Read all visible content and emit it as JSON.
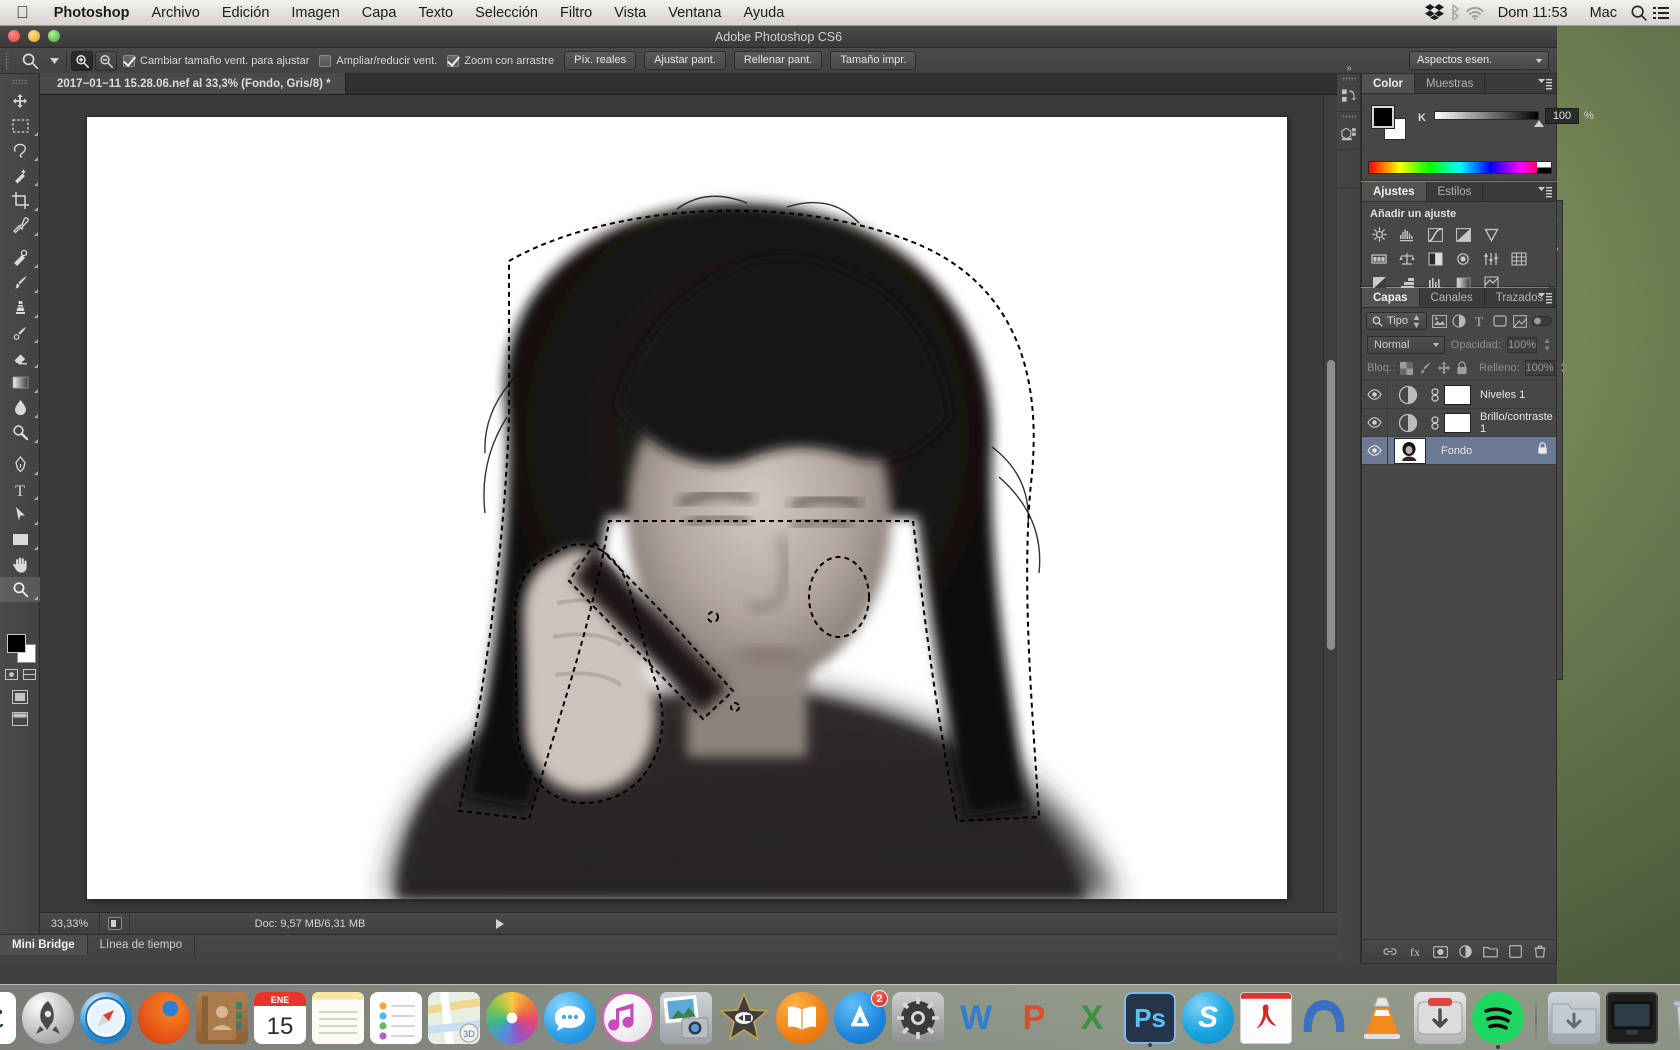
{
  "menubar": {
    "apple_icon": "apple-logo",
    "items": [
      {
        "label": "Photoshop",
        "bold": true
      },
      {
        "label": "Archivo",
        "bold": false
      },
      {
        "label": "Edición",
        "bold": false
      },
      {
        "label": "Imagen",
        "bold": false
      },
      {
        "label": "Capa",
        "bold": false
      },
      {
        "label": "Texto",
        "bold": false
      },
      {
        "label": "Selección",
        "bold": false
      },
      {
        "label": "Filtro",
        "bold": false
      },
      {
        "label": "Vista",
        "bold": false
      },
      {
        "label": "Ventana",
        "bold": false
      },
      {
        "label": "Ayuda",
        "bold": false
      }
    ],
    "status": {
      "dropbox_icon": "dropbox-icon",
      "bluetooth_icon": "bluetooth-icon",
      "wifi_icon": "wifi-icon",
      "clock": "Dom 11:53",
      "user": "Mac",
      "search_icon": "spotlight-search-icon",
      "notifications_icon": "notification-center-icon"
    }
  },
  "window": {
    "title": "Adobe Photoshop CS6"
  },
  "options_bar": {
    "tool_icon": "zoom-tool-icon",
    "preset_caret": "chevron-down-icon",
    "zoom_in_icon": "zoom-in-icon",
    "zoom_out_icon": "zoom-out-icon",
    "checkboxes": [
      {
        "label": "Cambiar tamaño vent. para ajustar",
        "checked": true
      },
      {
        "label": "Ampliar/reducir vent.",
        "checked": false
      },
      {
        "label": "Zoom con arrastre",
        "checked": true
      }
    ],
    "buttons": [
      "Píx. reales",
      "Ajustar pant.",
      "Rellenar pant.",
      "Tamaño impr."
    ],
    "workspace": "Aspectos esen."
  },
  "document": {
    "tab_close_icon": "close-icon",
    "tab_title": "2017−01−11 15.28.06.nef al 33,3% (Fondo, Gris/8) *"
  },
  "toolbar": {
    "tools": [
      {
        "name": "move-tool",
        "glyph": "move"
      },
      {
        "name": "marquee-tool",
        "glyph": "marquee"
      },
      {
        "name": "lasso-tool",
        "glyph": "lasso"
      },
      {
        "name": "quick-selection-tool",
        "glyph": "wand"
      },
      {
        "name": "crop-tool",
        "glyph": "crop"
      },
      {
        "name": "eyedropper-tool",
        "glyph": "eyedropper"
      },
      {
        "name": "spot-healing-tool",
        "glyph": "healing"
      },
      {
        "name": "brush-tool",
        "glyph": "brush"
      },
      {
        "name": "clone-stamp-tool",
        "glyph": "stamp"
      },
      {
        "name": "history-brush-tool",
        "glyph": "historybrush"
      },
      {
        "name": "eraser-tool",
        "glyph": "eraser"
      },
      {
        "name": "gradient-tool",
        "glyph": "gradient"
      },
      {
        "name": "blur-tool",
        "glyph": "blur"
      },
      {
        "name": "dodge-tool",
        "glyph": "dodge"
      },
      {
        "name": "pen-tool",
        "glyph": "pen"
      },
      {
        "name": "type-tool",
        "glyph": "type"
      },
      {
        "name": "path-selection-tool",
        "glyph": "pathsel"
      },
      {
        "name": "rectangle-tool",
        "glyph": "rect"
      },
      {
        "name": "hand-tool",
        "glyph": "hand"
      },
      {
        "name": "zoom-tool",
        "glyph": "zoom",
        "active": true
      }
    ],
    "foreground_color": "#000000",
    "background_color": "#ffffff"
  },
  "color_panel": {
    "tabs": [
      {
        "label": "Color",
        "selected": true
      },
      {
        "label": "Muestras",
        "selected": false
      }
    ],
    "channel_label": "K",
    "channel_value": "100",
    "unit": "%",
    "menu_icon": "panel-menu-icon"
  },
  "adjustments_panel": {
    "tabs": [
      {
        "label": "Ajustes",
        "selected": true
      },
      {
        "label": "Estilos",
        "selected": false
      }
    ],
    "heading": "Añadir un ajuste",
    "icons": [
      "brightness-contrast-icon",
      "levels-icon",
      "curves-icon",
      "exposure-icon",
      "vibrance-icon",
      "hue-saturation-icon",
      "color-balance-icon",
      "black-white-icon",
      "photo-filter-icon",
      "channel-mixer-icon",
      "color-lookup-icon",
      "invert-icon",
      "posterize-icon",
      "threshold-icon",
      "gradient-map-icon",
      "selective-color-icon"
    ],
    "menu_icon": "panel-menu-icon"
  },
  "layers_panel": {
    "tabs": [
      {
        "label": "Capas",
        "selected": true
      },
      {
        "label": "Canales",
        "selected": false
      },
      {
        "label": "Trazados",
        "selected": false
      }
    ],
    "menu_icon": "panel-menu-icon",
    "filter": {
      "search_icon": "search-icon",
      "kind_label": "Tipo",
      "filter_icons": [
        "filter-pixel-icon",
        "filter-adjustment-icon",
        "filter-type-icon",
        "filter-shape-icon",
        "filter-smart-icon"
      ],
      "toggle_icon": "filter-toggle-icon"
    },
    "blend_mode": "Normal",
    "opacity_label": "Opacidad:",
    "opacity_value": "100%",
    "lock_label": "Bloq.:",
    "lock_icons": [
      "lock-transparency-icon",
      "lock-image-icon",
      "lock-position-icon",
      "lock-all-icon"
    ],
    "fill_label": "Relleno:",
    "fill_value": "100%",
    "rows": [
      {
        "name": "Niveles 1",
        "visible": true,
        "type": "adjustment",
        "selected": false,
        "locked": false
      },
      {
        "name": "Brillo/contraste 1",
        "visible": true,
        "type": "adjustment",
        "selected": false,
        "locked": false
      },
      {
        "name": "Fondo",
        "visible": true,
        "type": "image",
        "selected": true,
        "locked": true
      }
    ],
    "footer_icons": [
      "link-layers-icon",
      "layer-style-icon",
      "layer-mask-icon",
      "new-group-icon",
      "new-layer-icon",
      "delete-layer-icon"
    ]
  },
  "status_bar": {
    "zoom": "33,33%",
    "proxy_icon": "document-proxy-icon",
    "doc_info": "Doc: 9,57 MB/6,31 MB",
    "arrow_icon": "chevron-right-icon"
  },
  "bottom_panel": {
    "tabs": [
      {
        "label": "Mini Bridge",
        "selected": true
      },
      {
        "label": "Línea de tiempo",
        "selected": false
      }
    ]
  },
  "canvas": {
    "alt": "Black and white photo of a woman holding a phone to her ear, with an active marching-ants selection around the hand and phone"
  },
  "dock": {
    "items": [
      {
        "name": "finder",
        "label": "Finder",
        "running": true
      },
      {
        "name": "launchpad",
        "label": "Launchpad",
        "running": false
      },
      {
        "name": "safari",
        "label": "Safari",
        "running": false
      },
      {
        "name": "firefox",
        "label": "Firefox",
        "running": false
      },
      {
        "name": "contacts",
        "label": "Contactos",
        "running": false
      },
      {
        "name": "calendar",
        "label": "Calendario",
        "running": false,
        "month": "ENE",
        "day": "15"
      },
      {
        "name": "notes",
        "label": "Notas",
        "running": false
      },
      {
        "name": "reminders",
        "label": "Recordatorios",
        "running": false
      },
      {
        "name": "maps",
        "label": "Mapas",
        "running": false
      },
      {
        "name": "photos",
        "label": "Fotos",
        "running": false
      },
      {
        "name": "messages",
        "label": "Mensajes",
        "running": false
      },
      {
        "name": "itunes",
        "label": "iTunes",
        "running": false
      },
      {
        "name": "iphoto",
        "label": "iPhoto",
        "running": false
      },
      {
        "name": "imovie",
        "label": "iMovie",
        "running": false
      },
      {
        "name": "ibooks",
        "label": "iBooks",
        "running": false
      },
      {
        "name": "app-store",
        "label": "App Store",
        "running": false,
        "badge": "2"
      },
      {
        "name": "system-preferences",
        "label": "Preferencias del Sistema",
        "running": false
      },
      {
        "name": "word",
        "label": "Word",
        "running": false,
        "glyph": "W"
      },
      {
        "name": "powerpoint",
        "label": "PowerPoint",
        "running": false,
        "glyph": "P"
      },
      {
        "name": "excel",
        "label": "Excel",
        "running": false,
        "glyph": "X"
      },
      {
        "name": "photoshop",
        "label": "Photoshop",
        "running": true,
        "glyph": "Ps"
      },
      {
        "name": "skype",
        "label": "Skype",
        "running": false,
        "glyph": "S"
      },
      {
        "name": "acrobat-reader",
        "label": "Adobe Reader",
        "running": false
      },
      {
        "name": "malwarebytes",
        "label": "Malwarebytes",
        "running": false
      },
      {
        "name": "vlc",
        "label": "VLC",
        "running": false
      },
      {
        "name": "transmission",
        "label": "Transmission",
        "running": false
      },
      {
        "name": "spotify",
        "label": "Spotify",
        "running": true
      }
    ],
    "right_items": [
      {
        "name": "downloads-folder",
        "label": "Descargas"
      },
      {
        "name": "screen-sharing",
        "label": "Pantalla"
      },
      {
        "name": "trash",
        "label": "Papelera"
      }
    ]
  }
}
